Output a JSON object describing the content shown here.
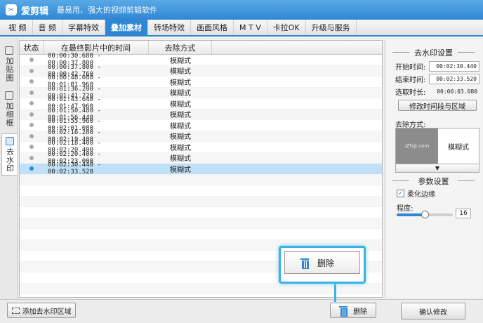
{
  "app": {
    "title": "爱剪辑",
    "slogan": "最易用、强大的视频剪辑软件"
  },
  "menu": {
    "tabs": [
      "视 频",
      "音 频",
      "字幕特效",
      "叠加素材",
      "转场特效",
      "画面风格",
      "M T V",
      "卡拉OK",
      "升级与服务"
    ],
    "active_index": 3
  },
  "sidebar": {
    "tabs": [
      {
        "label": "加贴图",
        "icon": "sticker-icon"
      },
      {
        "label": "加相框",
        "icon": "frame-icon"
      },
      {
        "label": "去水印",
        "icon": "watermark-icon"
      }
    ],
    "active_index": 2
  },
  "table": {
    "headers": [
      "状态",
      "在最终影片中的时间",
      "去除方式"
    ],
    "rows": [
      {
        "time": "00:00:30.680 - 00:00:37.800",
        "method": "模糊式",
        "selected": false
      },
      {
        "time": "00:00:37.800 - 00:00:42.760",
        "method": "模糊式",
        "selected": false
      },
      {
        "time": "00:00:48.080 - 00:01:01.960",
        "method": "模糊式",
        "selected": false
      },
      {
        "time": "00:01:36.200 - 00:01:41.720",
        "method": "模糊式",
        "selected": false
      },
      {
        "time": "00:01:43.640 - 00:01:47.960",
        "method": "模糊式",
        "selected": false
      },
      {
        "time": "00:01:50.480 - 00:01:56.440",
        "method": "模糊式",
        "selected": false
      },
      {
        "time": "00:01:55.960 - 00:02:01.080",
        "method": "模糊式",
        "selected": false
      },
      {
        "time": "00:02:16.280 - 00:02:19.400",
        "method": "模糊式",
        "selected": false
      },
      {
        "time": "00:02:18.400 - 00:02:20.400",
        "method": "模糊式",
        "selected": false
      },
      {
        "time": "00:02:20.400 - 00:02:23.000",
        "method": "模糊式",
        "selected": false
      },
      {
        "time": "00:02:30.440 - 00:02:33.520",
        "method": "模糊式",
        "selected": true
      }
    ]
  },
  "watermark_settings": {
    "title": "去水印设置",
    "start_label": "开始时间:",
    "start_value": "00:02:30.440",
    "end_label": "结束时间:",
    "end_value": "00:02:33.520",
    "duration_label": "选取时长:",
    "duration_value": "00:00:03.080",
    "modify_button": "修改时间段与区域",
    "method_label": "去除方式:",
    "method_thumb_text": "iZhiJi.com",
    "method_value": "模糊式",
    "dropdown_arrow": "▼"
  },
  "params": {
    "title": "参数设置",
    "soften_label": "柔化边缘",
    "soften_checked": true,
    "degree_label": "程度:",
    "degree_value": "16",
    "degree_level": 0.5
  },
  "bottom": {
    "add_button": "添加去水印区域",
    "delete_button": "删除",
    "confirm_button": "确认修改"
  },
  "callout": {
    "label": "删除"
  },
  "colors": {
    "accent": "#2f86d4",
    "highlight": "#38b3e6",
    "selected_row": "#bfe0f7"
  }
}
